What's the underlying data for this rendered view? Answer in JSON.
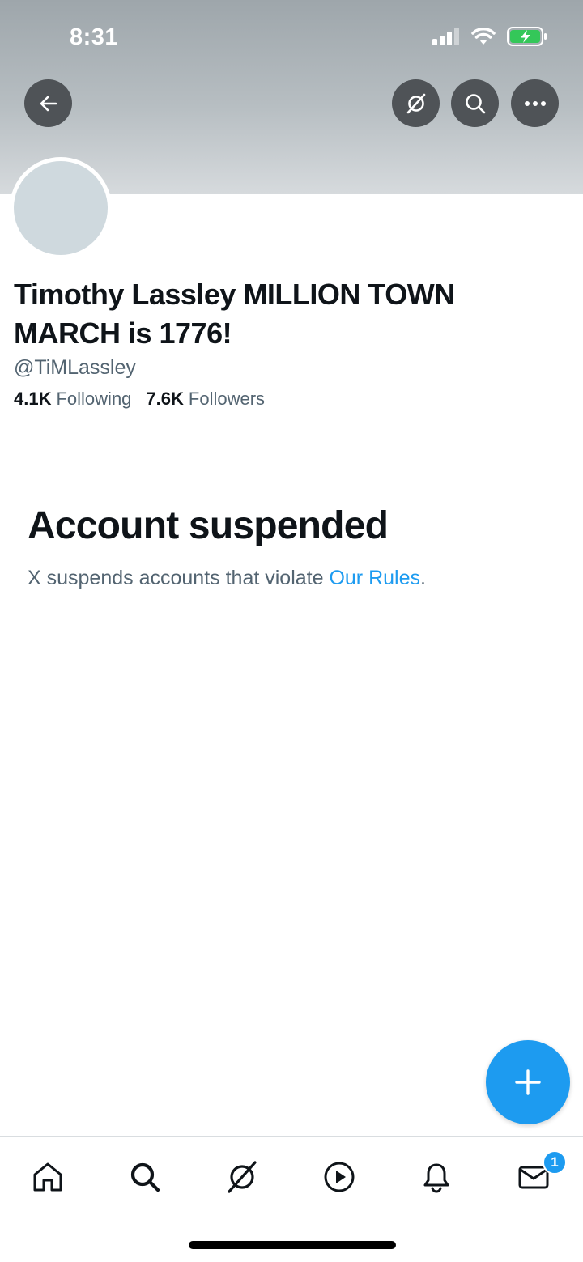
{
  "status_bar": {
    "time": "8:31"
  },
  "profile": {
    "display_name": "Timothy Lassley MILLION TOWN MARCH is 1776!",
    "handle": "@TiMLassley",
    "following_count": "4.1K",
    "following_label": "Following",
    "followers_count": "7.6K",
    "followers_label": "Followers"
  },
  "suspension": {
    "title": "Account suspended",
    "message_prefix": "X suspends accounts that violate ",
    "rules_link": "Our Rules",
    "message_suffix": "."
  },
  "notifications": {
    "messages_badge": "1"
  },
  "colors": {
    "accent": "#1d9bf0",
    "text_primary": "#0f1419",
    "text_secondary": "#536471",
    "header_button": "#4f5357"
  },
  "icons": {
    "header": [
      "back-arrow-icon",
      "grok-icon",
      "search-icon",
      "more-icon"
    ],
    "nav": [
      "home-icon",
      "search-icon",
      "grok-icon",
      "video-play-icon",
      "bell-icon",
      "mail-icon"
    ],
    "fab": "plus-icon"
  }
}
